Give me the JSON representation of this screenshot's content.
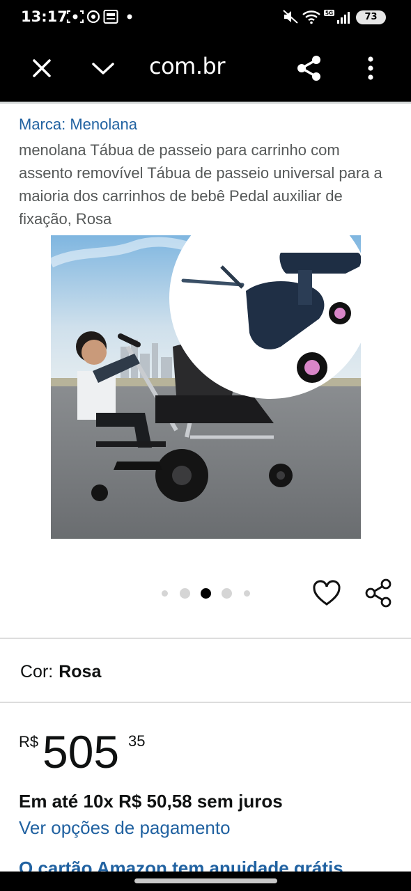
{
  "status_bar": {
    "time": "13:17",
    "network": "5G",
    "battery": "73"
  },
  "browser": {
    "url": "com.br"
  },
  "product": {
    "brand": "Marca: Menolana",
    "title": "menolana Tábua de passeio para carrinho com assento removível Tábua de passeio universal para a maioria dos carrinhos de bebê Pedal auxiliar de fixação, Rosa",
    "image_count": 5,
    "image_selected_index": 2
  },
  "color": {
    "label": "Cor:",
    "value": "Rosa"
  },
  "price": {
    "currency": "R$",
    "whole": "505",
    "cents": "35"
  },
  "installments": "Em até 10x R$ 50,58 sem juros",
  "payment_options_link": "Ver opções de pagamento",
  "promo_link": "O cartão Amazon tem anuidade grátis",
  "colors": {
    "link": "#2162a1",
    "text": "#0f1111",
    "muted": "#565959",
    "accent_pink": "#d986c8"
  }
}
